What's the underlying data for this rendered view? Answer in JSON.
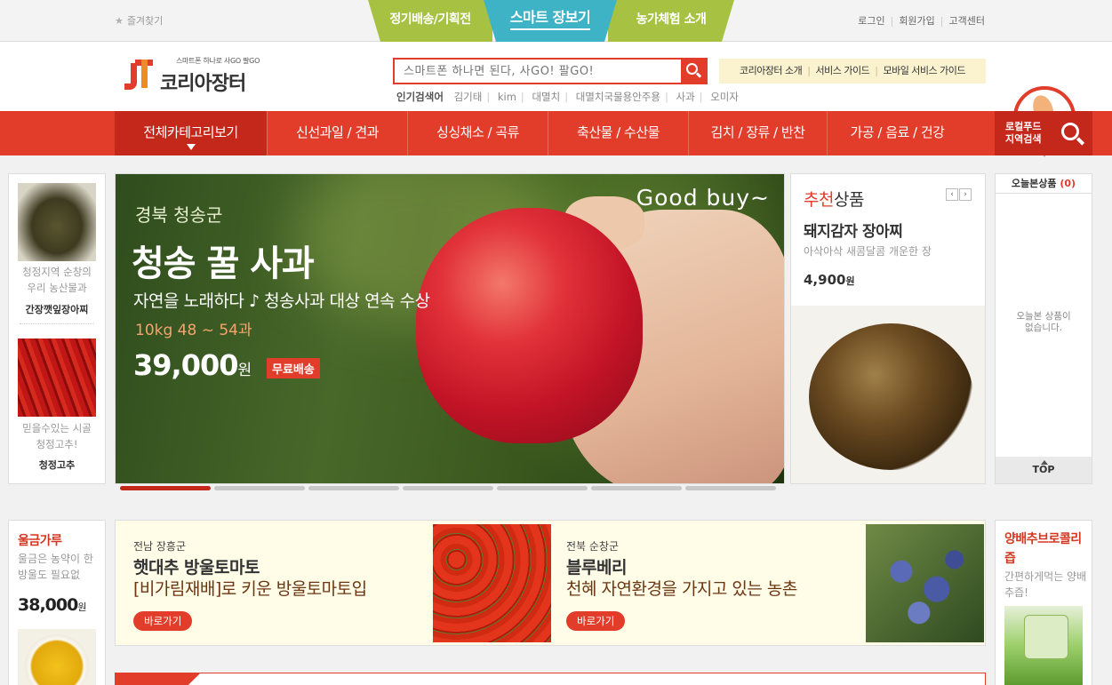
{
  "topbar": {
    "favorite": "즐겨찾기",
    "service_tabs": [
      "정기배송/기획전",
      "스마트 장보기",
      "농가체험 소개"
    ],
    "links": [
      "로그인",
      "회원가입",
      "고객센터"
    ]
  },
  "header": {
    "logo_slogan": "스마트폰 하나로 사GO 팔GO",
    "logo_name": "코리아장터",
    "search_placeholder": "스마트폰 하나면 된다, 사GO! 팔GO!",
    "popular_label": "인기검색어",
    "popular_terms": [
      "김기태",
      "kim",
      "대멸치",
      "대멸치국물용안주용",
      "사과",
      "오미자"
    ],
    "guide_links": [
      "코리아장터 소개",
      "서비스 가이드",
      "모바일 서비스 가이드"
    ]
  },
  "nav": {
    "all_categories": "전체카테고리보기",
    "items": [
      "신선과일 / 견과",
      "싱싱채소 / 곡류",
      "축산물 / 수산물",
      "김치 / 장류 / 반찬",
      "가공 / 음료 / 건강"
    ],
    "local_line1": "로컬푸드",
    "local_line2": "지역검색"
  },
  "left_products": [
    {
      "desc_line1": "청정지역 순창의",
      "desc_line2": "우리 농산물과",
      "name": "간장깻잎장아찌"
    },
    {
      "desc_line1": "믿을수있는 시골",
      "desc_line2": "청정고추!",
      "name": "청정고추"
    }
  ],
  "banner": {
    "goodbuy": "Good buy~",
    "region": "경북 청송군",
    "title": "청송 꿀 사과",
    "subtitle": "자연을 노래하다 ♪ 청송사과 대상 연속 수상",
    "spec": "10kg  48 ~ 54과",
    "price": "39,000",
    "price_unit": "원",
    "badge": "무료배송",
    "slide_count": 7,
    "active_slide": 1
  },
  "recommend": {
    "heading_hl": "추천",
    "heading_rest": "상품",
    "name": "돼지감자 장아찌",
    "desc": "아삭아삭 새콤달콤 개운한 장",
    "price": "4,900",
    "price_unit": "원"
  },
  "today": {
    "label": "오늘본상품",
    "count": "(0)",
    "empty_line1": "오늘본 상품이",
    "empty_line2": "없습니다.",
    "top": "TOP"
  },
  "bottom_left": {
    "name": "울금가루",
    "desc": "울금은 농약이 한 방울도 필요없",
    "price": "38,000",
    "price_unit": "원"
  },
  "promos": [
    {
      "region": "전남 장흥군",
      "title": "햇대추 방울토마토",
      "subtitle": "[비가림재배]로 키운 방울토마토입",
      "button": "바로가기"
    },
    {
      "region": "전북 순창군",
      "title": "블루베리",
      "subtitle": "천혜 자연환경을 가지고 있는 농촌",
      "button": "바로가기"
    }
  ],
  "bottom_right": {
    "name": "양배추브로콜리즙",
    "desc": "간편하게먹는 양배추즙!"
  }
}
